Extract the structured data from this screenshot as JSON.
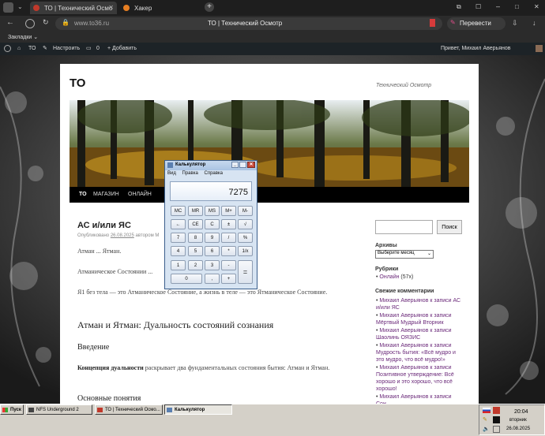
{
  "browser": {
    "tabs": [
      {
        "label": "ТО | Технический Осмо",
        "active": true
      },
      {
        "label": "Хакер",
        "active": false
      }
    ],
    "url": "www.to36.ru",
    "page_title": "ТО | Технический Осмотр",
    "translate_label": "Перевести",
    "bookmarks_label": "Закладки"
  },
  "wpbar": {
    "site": "ТО",
    "customize": "Настроить",
    "comments_count": "0",
    "add": "+ Добавить",
    "greeting": "Привет, Михаил Аверьянов"
  },
  "site": {
    "title": "ТО",
    "description": "Технический Осмотр",
    "nav": [
      "ТО",
      "МАГАЗИН",
      "ОНЛАЙН"
    ]
  },
  "post": {
    "title": "АС и/или ЯС",
    "meta_prefix": "Опубликовано",
    "date": "26.08.2025",
    "meta_author": "автором М",
    "p1": "Атман ... Ятман.",
    "p2": "Атманическое Состоянии ...",
    "p3": "Я1 без тела — это Атманическое Состояние, а жизнь в теле — это Ятманическое Состояние.",
    "h2": "Атман и Ятман: Дуальность состояний сознания",
    "h3a": "Введение",
    "p4_bold": "Концепция дуальности",
    "p4_rest": " раскрывает два фундаментальных состояния бытия: Атман и Ятман.",
    "h3b": "Основные понятия"
  },
  "sidebar": {
    "search_button": "Поиск",
    "archives_title": "Архивы",
    "archives_select": "Выберите месяц",
    "rubrics_title": "Рубрики",
    "rubric_item_link": "Онлайн",
    "rubric_item_count": " (57x)",
    "comments_title": "Свежие комментарии",
    "comments": [
      {
        "author": "Михаил Аверьянов",
        "text": " к записи АС и/или ЯС"
      },
      {
        "author": "Михаил Аверьянов",
        "text": " к записи Мёртвый Мудрый Вторник"
      },
      {
        "author": "Михаил Аверьянов",
        "text": " к записи Шаолинь ОЯЗИС"
      },
      {
        "author": "Михаил Аверьянов",
        "text": " к записи Мудрость бытия: «Всё мудро и это мудро, что всё мудро!»"
      },
      {
        "author": "Михаил Аверьянов",
        "text": " к записи Позитивное утверждение: Всё хорошо и это хорошо, что всё хорошо!"
      },
      {
        "author": "Михаил Аверьянов",
        "text": " к записи Сон"
      }
    ]
  },
  "calculator": {
    "title": "Калькулятор",
    "menu": [
      "Вид",
      "Правка",
      "Справка"
    ],
    "display": "7275",
    "buttons": [
      [
        "MC",
        "MR",
        "MS",
        "M+",
        "M-"
      ],
      [
        "←",
        "CE",
        "C",
        "±",
        "√"
      ],
      [
        "7",
        "8",
        "9",
        "/",
        "%"
      ],
      [
        "4",
        "5",
        "6",
        "*",
        "1/x"
      ],
      [
        "1",
        "2",
        "3",
        "-",
        "="
      ],
      [
        "0",
        ",",
        "+"
      ]
    ]
  },
  "taskbar": {
    "start": "Пуск",
    "items": [
      "NFS Underground 2",
      "ТО | Технический Осмо...",
      "Калькулятор"
    ],
    "time": "20:04",
    "weekday": "вторник",
    "date": "26.08.2025"
  }
}
